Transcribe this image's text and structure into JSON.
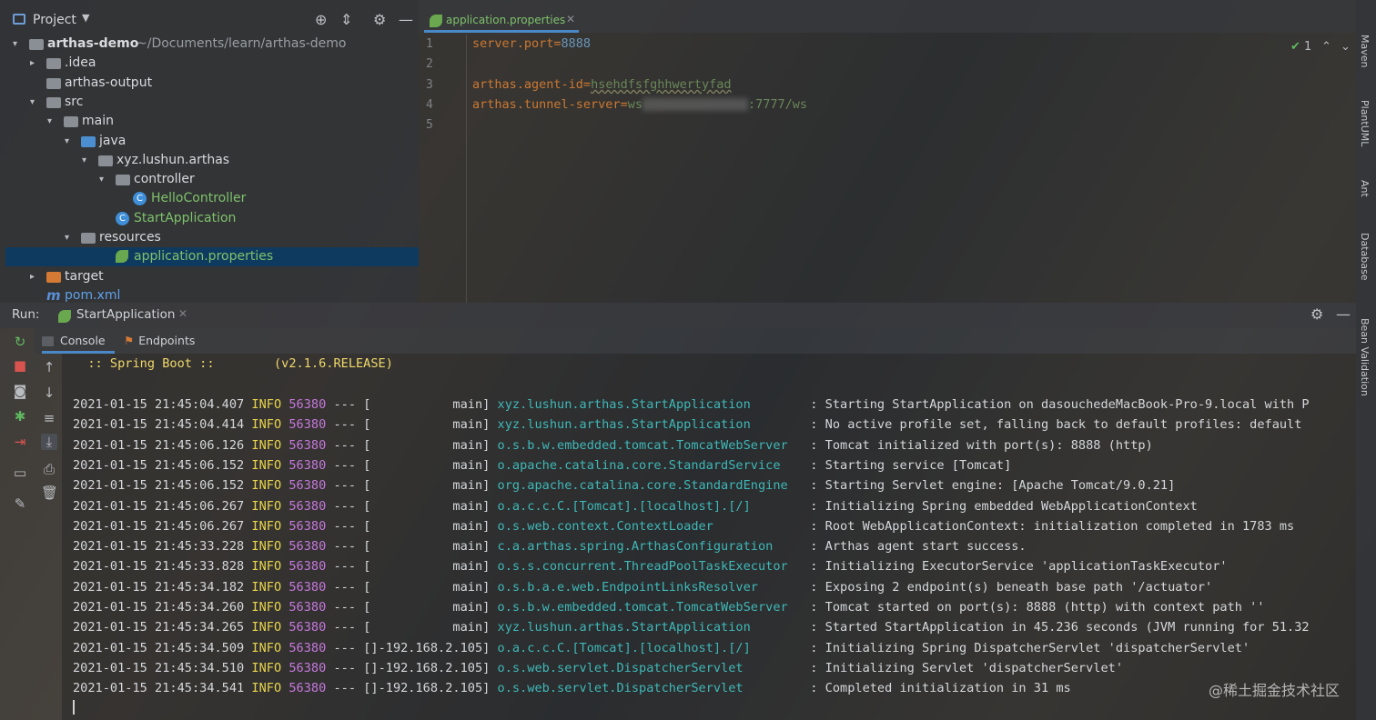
{
  "project": {
    "title": "Project",
    "tree": [
      {
        "label": "arthas-demo",
        "path": "~/Documents/learn/arthas-demo",
        "icon": "module-folder-icon",
        "arrow": "▾",
        "depth": 0
      },
      {
        "label": ".idea",
        "icon": "folder-icon",
        "arrow": "▸",
        "depth": 1
      },
      {
        "label": "arthas-output",
        "icon": "folder-icon",
        "arrow": "",
        "depth": 1
      },
      {
        "label": "src",
        "icon": "folder-icon",
        "arrow": "▾",
        "depth": 1
      },
      {
        "label": "main",
        "icon": "folder-icon",
        "arrow": "▾",
        "depth": 2
      },
      {
        "label": "java",
        "icon": "source-folder-icon",
        "arrow": "▾",
        "depth": 3
      },
      {
        "label": "xyz.lushun.arthas",
        "icon": "package-icon",
        "arrow": "▾",
        "depth": 4
      },
      {
        "label": "controller",
        "icon": "package-icon",
        "arrow": "▾",
        "depth": 5
      },
      {
        "label": "HelloController",
        "icon": "class-icon",
        "arrow": "",
        "depth": 6
      },
      {
        "label": "StartApplication",
        "icon": "spring-class-icon",
        "arrow": "",
        "depth": 5
      },
      {
        "label": "resources",
        "icon": "resources-folder-icon",
        "arrow": "▾",
        "depth": 3
      },
      {
        "label": "application.properties",
        "icon": "spring-properties-icon",
        "arrow": "",
        "depth": 5
      },
      {
        "label": "target",
        "icon": "excluded-folder-icon",
        "arrow": "▸",
        "depth": 1
      },
      {
        "label": "pom.xml",
        "icon": "maven-icon",
        "arrow": "",
        "depth": 1
      }
    ]
  },
  "editor": {
    "tab_label": "application.properties",
    "line_numbers": [
      "1",
      "2",
      "3",
      "4",
      "5"
    ],
    "lines": {
      "l1_key": "server.port",
      "l1_eq": "=",
      "l1_val": "8888",
      "l3_key": "arthas.agent-id",
      "l3_eq": "=",
      "l3_val": "hsehdfsfghhwertyfad",
      "l4_key": "arthas.tunnel-server",
      "l4_eq": "=",
      "l4_val_pre": "ws",
      "l4_val_post": ":7777/ws"
    },
    "inspection_count": "1"
  },
  "right_stripe": [
    "Maven",
    "PlantUML",
    "Ant",
    "Database",
    "Bean Validation"
  ],
  "run": {
    "label": "Run:",
    "tab_label": "StartApplication",
    "subtabs": [
      "Console",
      "Endpoints"
    ]
  },
  "console": {
    "banner": "  :: Spring Boot ::        (v2.1.6.RELEASE)",
    "logs": [
      {
        "ts": "2021-01-15 21:45:04.407",
        "level": "INFO",
        "pid": "56380",
        "sep": " --- [",
        "thread": "           main] ",
        "logger": "xyz.lushun.arthas.StartApplication       ",
        "msg": " : Starting StartApplication on dasouchedeMacBook-Pro-9.local with P"
      },
      {
        "ts": "2021-01-15 21:45:04.414",
        "level": "INFO",
        "pid": "56380",
        "sep": " --- [",
        "thread": "           main] ",
        "logger": "xyz.lushun.arthas.StartApplication       ",
        "msg": " : No active profile set, falling back to default profiles: default"
      },
      {
        "ts": "2021-01-15 21:45:06.126",
        "level": "INFO",
        "pid": "56380",
        "sep": " --- [",
        "thread": "           main] ",
        "logger": "o.s.b.w.embedded.tomcat.TomcatWebServer  ",
        "msg": " : Tomcat initialized with port(s): 8888 (http)"
      },
      {
        "ts": "2021-01-15 21:45:06.152",
        "level": "INFO",
        "pid": "56380",
        "sep": " --- [",
        "thread": "           main] ",
        "logger": "o.apache.catalina.core.StandardService   ",
        "msg": " : Starting service [Tomcat]"
      },
      {
        "ts": "2021-01-15 21:45:06.152",
        "level": "INFO",
        "pid": "56380",
        "sep": " --- [",
        "thread": "           main] ",
        "logger": "org.apache.catalina.core.StandardEngine  ",
        "msg": " : Starting Servlet engine: [Apache Tomcat/9.0.21]"
      },
      {
        "ts": "2021-01-15 21:45:06.267",
        "level": "INFO",
        "pid": "56380",
        "sep": " --- [",
        "thread": "           main] ",
        "logger": "o.a.c.c.C.[Tomcat].[localhost].[/]       ",
        "msg": " : Initializing Spring embedded WebApplicationContext"
      },
      {
        "ts": "2021-01-15 21:45:06.267",
        "level": "INFO",
        "pid": "56380",
        "sep": " --- [",
        "thread": "           main] ",
        "logger": "o.s.web.context.ContextLoader            ",
        "msg": " : Root WebApplicationContext: initialization completed in 1783 ms"
      },
      {
        "ts": "2021-01-15 21:45:33.228",
        "level": "INFO",
        "pid": "56380",
        "sep": " --- [",
        "thread": "           main] ",
        "logger": "c.a.arthas.spring.ArthasConfiguration    ",
        "msg": " : Arthas agent start success."
      },
      {
        "ts": "2021-01-15 21:45:33.828",
        "level": "INFO",
        "pid": "56380",
        "sep": " --- [",
        "thread": "           main] ",
        "logger": "o.s.s.concurrent.ThreadPoolTaskExecutor  ",
        "msg": " : Initializing ExecutorService 'applicationTaskExecutor'"
      },
      {
        "ts": "2021-01-15 21:45:34.182",
        "level": "INFO",
        "pid": "56380",
        "sep": " --- [",
        "thread": "           main] ",
        "logger": "o.s.b.a.e.web.EndpointLinksResolver      ",
        "msg": " : Exposing 2 endpoint(s) beneath base path '/actuator'"
      },
      {
        "ts": "2021-01-15 21:45:34.260",
        "level": "INFO",
        "pid": "56380",
        "sep": " --- [",
        "thread": "           main] ",
        "logger": "o.s.b.w.embedded.tomcat.TomcatWebServer  ",
        "msg": " : Tomcat started on port(s): 8888 (http) with context path ''"
      },
      {
        "ts": "2021-01-15 21:45:34.265",
        "level": "INFO",
        "pid": "56380",
        "sep": " --- [",
        "thread": "           main] ",
        "logger": "xyz.lushun.arthas.StartApplication       ",
        "msg": " : Started StartApplication in 45.236 seconds (JVM running for 51.32"
      },
      {
        "ts": "2021-01-15 21:45:34.509",
        "level": "INFO",
        "pid": "56380",
        "sep": " --- [",
        "thread": "]-192.168.2.105] ",
        "logger": "o.a.c.c.C.[Tomcat].[localhost].[/]       ",
        "msg": " : Initializing Spring DispatcherServlet 'dispatcherServlet'"
      },
      {
        "ts": "2021-01-15 21:45:34.510",
        "level": "INFO",
        "pid": "56380",
        "sep": " --- [",
        "thread": "]-192.168.2.105] ",
        "logger": "o.s.web.servlet.DispatcherServlet        ",
        "msg": " : Initializing Servlet 'dispatcherServlet'"
      },
      {
        "ts": "2021-01-15 21:45:34.541",
        "level": "INFO",
        "pid": "56380",
        "sep": " --- [",
        "thread": "]-192.168.2.105] ",
        "logger": "o.s.web.servlet.DispatcherServlet        ",
        "msg": " : Completed initialization in 31 ms"
      }
    ]
  },
  "watermark": "@稀土掘金技术社区"
}
